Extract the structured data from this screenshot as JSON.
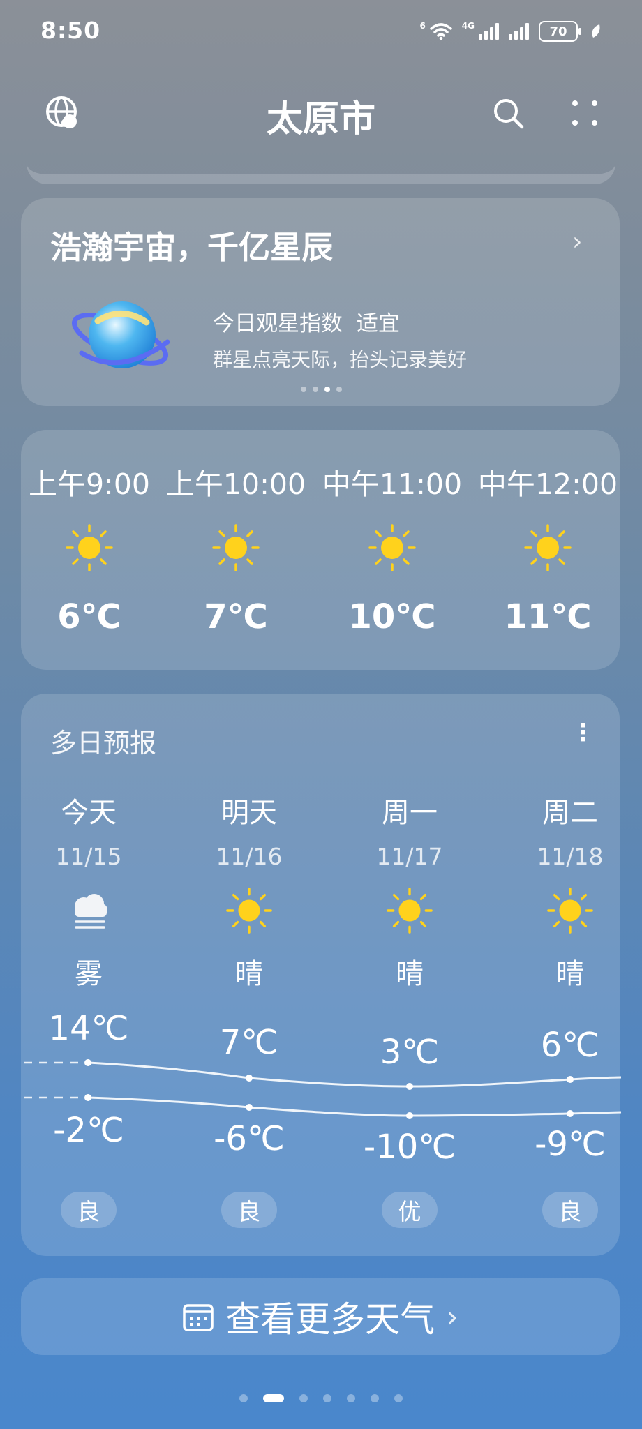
{
  "status_bar": {
    "time": "8:50",
    "wifi_tag": "6",
    "net_tag": "4G",
    "battery": "70"
  },
  "header": {
    "city": "太原市",
    "left_icon": "globe-icon",
    "search_icon": "search-icon",
    "menu_icon": "more-dots-icon"
  },
  "star_card": {
    "title": "浩瀚宇宙，千亿星辰",
    "index_label": "今日观星指数",
    "index_value": "适宜",
    "subtitle": "群星点亮天际，抬头记录美好",
    "page_indicator": {
      "count": 4,
      "active": 2
    }
  },
  "hourly": [
    {
      "time": "上午9:00",
      "icon": "sun-icon",
      "temp": "6℃"
    },
    {
      "time": "上午10:00",
      "icon": "sun-icon",
      "temp": "7℃"
    },
    {
      "time": "中午11:00",
      "icon": "sun-icon",
      "temp": "10℃"
    },
    {
      "time": "中午12:00",
      "icon": "sun-icon",
      "temp": "11℃"
    }
  ],
  "daily": {
    "title": "多日预报",
    "days": [
      {
        "name": "今天",
        "date": "11/15",
        "icon": "fog-icon",
        "condition": "雾",
        "high": "14℃",
        "low": "-2℃",
        "aqi": "良"
      },
      {
        "name": "明天",
        "date": "11/16",
        "icon": "sun-icon",
        "condition": "晴",
        "high": "7℃",
        "low": "-6℃",
        "aqi": "良"
      },
      {
        "name": "周一",
        "date": "11/17",
        "icon": "sun-icon",
        "condition": "晴",
        "high": "3℃",
        "low": "-10℃",
        "aqi": "优"
      },
      {
        "name": "周二",
        "date": "11/18",
        "icon": "sun-icon",
        "condition": "晴",
        "high": "6℃",
        "low": "-9℃",
        "aqi": "良"
      }
    ]
  },
  "more_button": {
    "label": "查看更多天气",
    "icon": "calendar-icon"
  },
  "page_dots": {
    "count": 7,
    "active": 1
  },
  "colors": {
    "sun": "#ffd21c",
    "planet": "#3aa5e8",
    "ring": "#5a6bf0"
  }
}
